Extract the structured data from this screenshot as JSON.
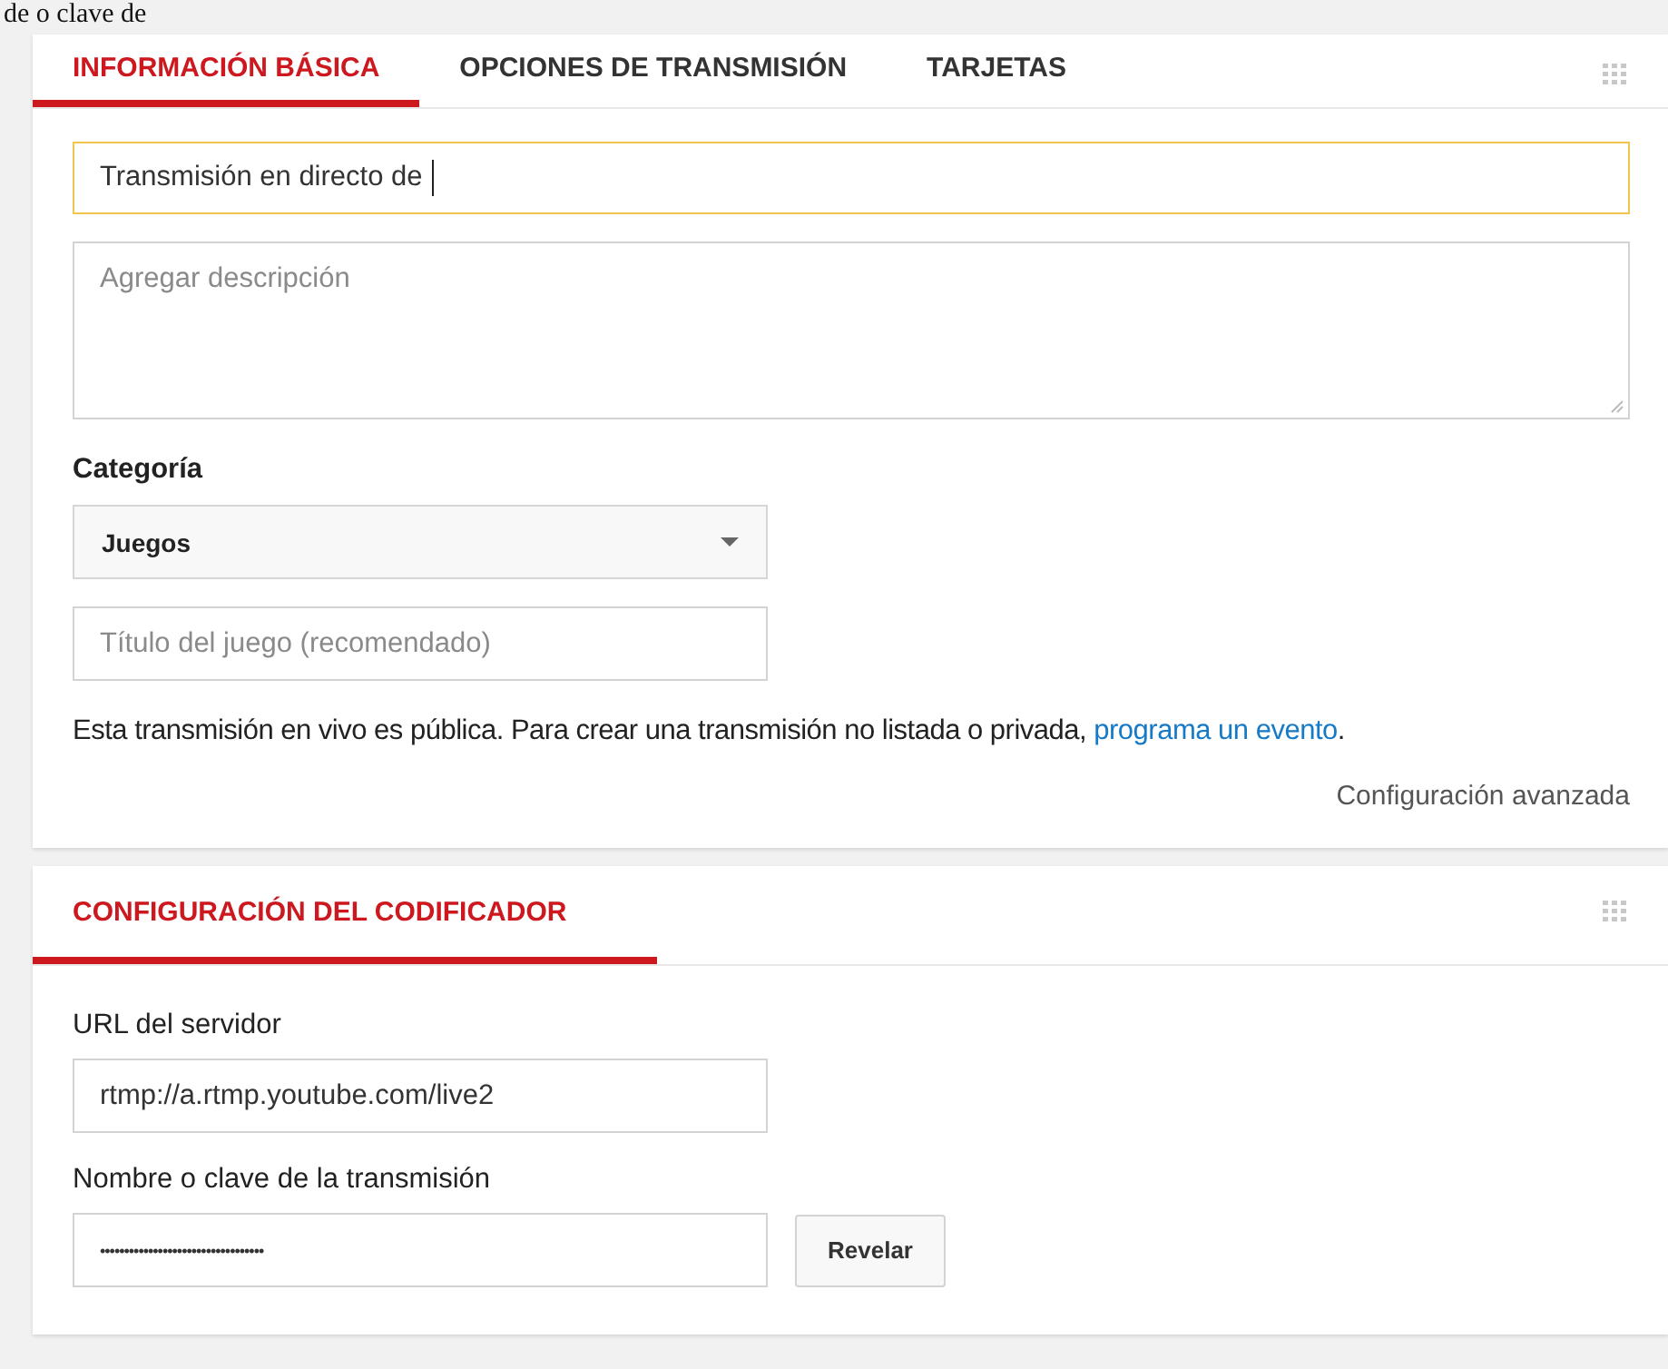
{
  "caption_fragment": "de o clave de",
  "tabs": [
    {
      "label": "INFORMACIÓN BÁSICA",
      "selected": true
    },
    {
      "label": "OPCIONES DE TRANSMISIÓN",
      "selected": false
    },
    {
      "label": "TARJETAS",
      "selected": false
    }
  ],
  "basic_info": {
    "title_field": {
      "value": "Transmisión en directo de ",
      "focused": true
    },
    "description_field": {
      "placeholder": "Agregar descripción"
    },
    "category_label": "Categoría",
    "category_select": {
      "value": "Juegos"
    },
    "game_title_field": {
      "placeholder": "Título del juego (recomendado)"
    },
    "privacy_note": {
      "text": "Esta transmisión en vivo es pública. Para crear una transmisión no listada o privada, ",
      "link": "programa un evento",
      "end": "."
    },
    "advanced_link": "Configuración avanzada"
  },
  "encoder": {
    "tabs": [
      {
        "label": "CONFIGURACIÓN DEL CODIFICADOR",
        "selected": true
      }
    ],
    "server_label": "URL del servidor",
    "server_field": {
      "value": "rtmp://a.rtmp.youtube.com/live2"
    },
    "key_label": "Nombre o clave de la transmisión",
    "key_field": {
      "value": "••••••••••••••••••••••••••••••••••"
    },
    "reveal_button": "Revelar"
  }
}
